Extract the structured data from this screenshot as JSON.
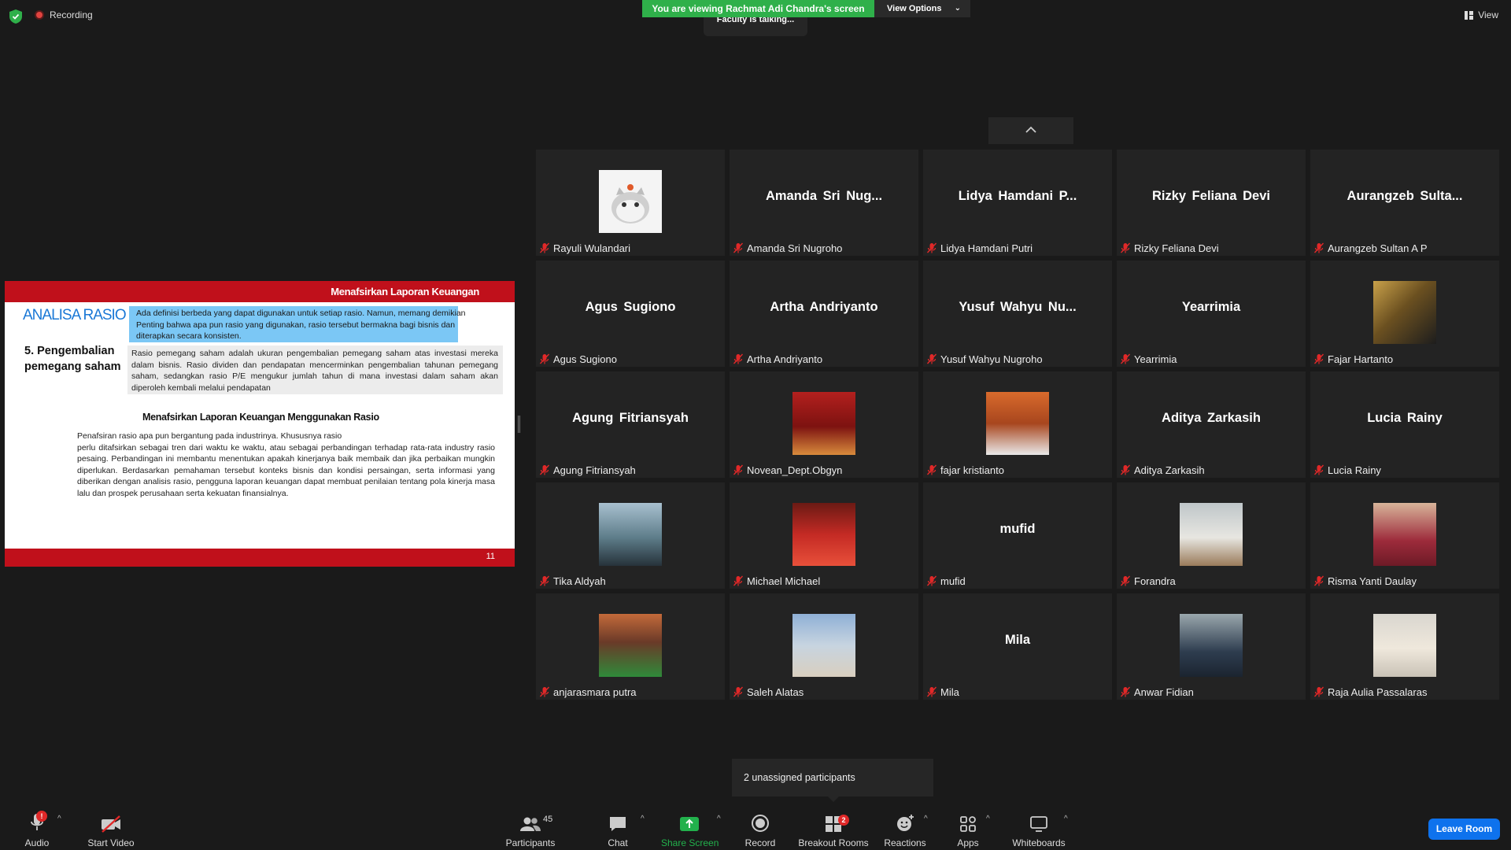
{
  "topbar": {
    "recording_label": "Recording",
    "banner": "You are viewing Rachmat Adi Chandra's screen",
    "view_options": "View Options",
    "talking": "Faculty is talking...",
    "view": "View"
  },
  "slide": {
    "header": "Menafsirkan Laporan Keuangan",
    "title": "ANALISA RASIO",
    "blue_text": "Ada definisi berbeda yang dapat digunakan untuk setiap rasio. Namun, memang demikian Penting bahwa apa pun rasio yang digunakan, rasio tersebut bermakna bagi bisnis dan diterapkan secara konsisten.",
    "section_line1": "5. Pengembalian",
    "section_line2": "pemegang saham",
    "grey_text": "Rasio pemegang saham adalah ukuran pengembalian pemegang saham atas investasi mereka dalam bisnis. Rasio dividen dan pendapatan mencerminkan pengembalian tahunan pemegang saham, sedangkan rasio P/E mengukur jumlah tahun di mana investasi dalam saham akan diperoleh kembali melalui pendapatan",
    "mid_title": "Menafsirkan Laporan Keuangan Menggunakan Rasio",
    "body_line1": "Penafsiran rasio apa pun bergantung pada industrinya. Khususnya rasio",
    "body_rest": "perlu ditafsirkan sebagai tren dari waktu ke waktu, atau sebagai perbandingan terhadap rata-rata industry rasio pesaing. Perbandingan ini membantu menentukan apakah kinerjanya baik membaik dan jika perbaikan mungkin diperlukan. Berdasarkan pemahaman tersebut konteks bisnis dan kondisi persaingan, serta informasi yang diberikan dengan analisis rasio, pengguna laporan keuangan dapat membuat penilaian tentang pola kinerja masa lalu dan prospek perusahaan serta kekuatan finansialnya.",
    "page_number": "11"
  },
  "participants": [
    {
      "display": "",
      "label": "Rayuli Wulandari",
      "photo": "cat"
    },
    {
      "display": "Amanda Sri Nug...",
      "label": "Amanda Sri Nugroho"
    },
    {
      "display": "Lidya Hamdani P...",
      "label": "Lidya Hamdani Putri"
    },
    {
      "display": "Rizky Feliana Devi",
      "label": "Rizky Feliana Devi"
    },
    {
      "display": "Aurangzeb Sulta...",
      "label": "Aurangzeb Sultan A P"
    },
    {
      "display": "Agus Sugiono",
      "label": "Agus Sugiono"
    },
    {
      "display": "Artha Andriyanto",
      "label": "Artha Andriyanto"
    },
    {
      "display": "Yusuf Wahyu Nu...",
      "label": "Yusuf Wahyu Nugroho"
    },
    {
      "display": "Yearrimia",
      "label": "Yearrimia"
    },
    {
      "display": "",
      "label": "Fajar Hartanto",
      "photo": "man-gold"
    },
    {
      "display": "Agung Fitriansyah",
      "label": "Agung Fitriansyah"
    },
    {
      "display": "",
      "label": "Novean_Dept.Obgyn",
      "photo": "man-red"
    },
    {
      "display": "",
      "label": "fajar kristianto",
      "photo": "man-shirt"
    },
    {
      "display": "Aditya Zarkasih",
      "label": "Aditya Zarkasih"
    },
    {
      "display": "Lucia Rainy",
      "label": "Lucia Rainy"
    },
    {
      "display": "",
      "label": "Tika Aldyah",
      "photo": "sea"
    },
    {
      "display": "",
      "label": "Michael Michael",
      "photo": "man-redshirt"
    },
    {
      "display": "mufid",
      "label": "mufid"
    },
    {
      "display": "",
      "label": "Forandra",
      "photo": "room"
    },
    {
      "display": "",
      "label": "Risma Yanti Daulay",
      "photo": "grad"
    },
    {
      "display": "",
      "label": "anjarasmara putra",
      "photo": "green"
    },
    {
      "display": "",
      "label": "Saleh Alatas",
      "photo": "beach"
    },
    {
      "display": "Mila",
      "label": "Mila"
    },
    {
      "display": "",
      "label": "Anwar Fidian",
      "photo": "man-suit"
    },
    {
      "display": "",
      "label": "Raja Aulia Passalaras",
      "photo": "hijab"
    }
  ],
  "popup": {
    "unassigned": "2 unassigned participants"
  },
  "toolbar": {
    "audio": "Audio",
    "audio_badge": "!",
    "start_video": "Start Video",
    "participants": "Participants",
    "participants_count": "45",
    "chat": "Chat",
    "share_screen": "Share Screen",
    "record": "Record",
    "breakout_rooms": "Breakout Rooms",
    "breakout_badge": "2",
    "reactions": "Reactions",
    "apps": "Apps",
    "whiteboards": "Whiteboards",
    "leave": "Leave Room"
  },
  "colors": {
    "banner_green": "#2fb04a",
    "slide_red": "#c0101b",
    "leave_blue": "#0e72ed",
    "share_green": "#22b14c",
    "mute_red": "#e02828"
  }
}
